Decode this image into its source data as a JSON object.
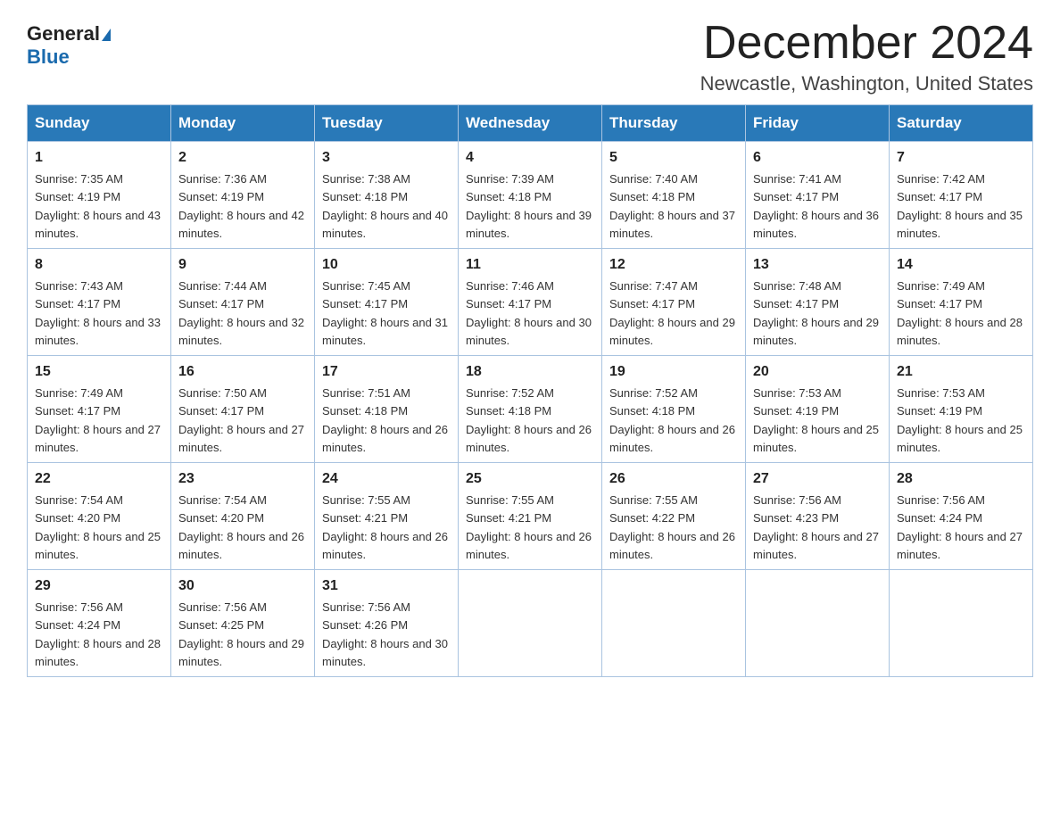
{
  "header": {
    "logo_general": "General",
    "logo_blue": "Blue",
    "month_title": "December 2024",
    "location": "Newcastle, Washington, United States"
  },
  "days_of_week": [
    "Sunday",
    "Monday",
    "Tuesday",
    "Wednesday",
    "Thursday",
    "Friday",
    "Saturday"
  ],
  "weeks": [
    [
      {
        "day": "1",
        "sunrise": "7:35 AM",
        "sunset": "4:19 PM",
        "daylight": "8 hours and 43 minutes."
      },
      {
        "day": "2",
        "sunrise": "7:36 AM",
        "sunset": "4:19 PM",
        "daylight": "8 hours and 42 minutes."
      },
      {
        "day": "3",
        "sunrise": "7:38 AM",
        "sunset": "4:18 PM",
        "daylight": "8 hours and 40 minutes."
      },
      {
        "day": "4",
        "sunrise": "7:39 AM",
        "sunset": "4:18 PM",
        "daylight": "8 hours and 39 minutes."
      },
      {
        "day": "5",
        "sunrise": "7:40 AM",
        "sunset": "4:18 PM",
        "daylight": "8 hours and 37 minutes."
      },
      {
        "day": "6",
        "sunrise": "7:41 AM",
        "sunset": "4:17 PM",
        "daylight": "8 hours and 36 minutes."
      },
      {
        "day": "7",
        "sunrise": "7:42 AM",
        "sunset": "4:17 PM",
        "daylight": "8 hours and 35 minutes."
      }
    ],
    [
      {
        "day": "8",
        "sunrise": "7:43 AM",
        "sunset": "4:17 PM",
        "daylight": "8 hours and 33 minutes."
      },
      {
        "day": "9",
        "sunrise": "7:44 AM",
        "sunset": "4:17 PM",
        "daylight": "8 hours and 32 minutes."
      },
      {
        "day": "10",
        "sunrise": "7:45 AM",
        "sunset": "4:17 PM",
        "daylight": "8 hours and 31 minutes."
      },
      {
        "day": "11",
        "sunrise": "7:46 AM",
        "sunset": "4:17 PM",
        "daylight": "8 hours and 30 minutes."
      },
      {
        "day": "12",
        "sunrise": "7:47 AM",
        "sunset": "4:17 PM",
        "daylight": "8 hours and 29 minutes."
      },
      {
        "day": "13",
        "sunrise": "7:48 AM",
        "sunset": "4:17 PM",
        "daylight": "8 hours and 29 minutes."
      },
      {
        "day": "14",
        "sunrise": "7:49 AM",
        "sunset": "4:17 PM",
        "daylight": "8 hours and 28 minutes."
      }
    ],
    [
      {
        "day": "15",
        "sunrise": "7:49 AM",
        "sunset": "4:17 PM",
        "daylight": "8 hours and 27 minutes."
      },
      {
        "day": "16",
        "sunrise": "7:50 AM",
        "sunset": "4:17 PM",
        "daylight": "8 hours and 27 minutes."
      },
      {
        "day": "17",
        "sunrise": "7:51 AM",
        "sunset": "4:18 PM",
        "daylight": "8 hours and 26 minutes."
      },
      {
        "day": "18",
        "sunrise": "7:52 AM",
        "sunset": "4:18 PM",
        "daylight": "8 hours and 26 minutes."
      },
      {
        "day": "19",
        "sunrise": "7:52 AM",
        "sunset": "4:18 PM",
        "daylight": "8 hours and 26 minutes."
      },
      {
        "day": "20",
        "sunrise": "7:53 AM",
        "sunset": "4:19 PM",
        "daylight": "8 hours and 25 minutes."
      },
      {
        "day": "21",
        "sunrise": "7:53 AM",
        "sunset": "4:19 PM",
        "daylight": "8 hours and 25 minutes."
      }
    ],
    [
      {
        "day": "22",
        "sunrise": "7:54 AM",
        "sunset": "4:20 PM",
        "daylight": "8 hours and 25 minutes."
      },
      {
        "day": "23",
        "sunrise": "7:54 AM",
        "sunset": "4:20 PM",
        "daylight": "8 hours and 26 minutes."
      },
      {
        "day": "24",
        "sunrise": "7:55 AM",
        "sunset": "4:21 PM",
        "daylight": "8 hours and 26 minutes."
      },
      {
        "day": "25",
        "sunrise": "7:55 AM",
        "sunset": "4:21 PM",
        "daylight": "8 hours and 26 minutes."
      },
      {
        "day": "26",
        "sunrise": "7:55 AM",
        "sunset": "4:22 PM",
        "daylight": "8 hours and 26 minutes."
      },
      {
        "day": "27",
        "sunrise": "7:56 AM",
        "sunset": "4:23 PM",
        "daylight": "8 hours and 27 minutes."
      },
      {
        "day": "28",
        "sunrise": "7:56 AM",
        "sunset": "4:24 PM",
        "daylight": "8 hours and 27 minutes."
      }
    ],
    [
      {
        "day": "29",
        "sunrise": "7:56 AM",
        "sunset": "4:24 PM",
        "daylight": "8 hours and 28 minutes."
      },
      {
        "day": "30",
        "sunrise": "7:56 AM",
        "sunset": "4:25 PM",
        "daylight": "8 hours and 29 minutes."
      },
      {
        "day": "31",
        "sunrise": "7:56 AM",
        "sunset": "4:26 PM",
        "daylight": "8 hours and 30 minutes."
      },
      null,
      null,
      null,
      null
    ]
  ],
  "labels": {
    "sunrise": "Sunrise:",
    "sunset": "Sunset:",
    "daylight": "Daylight:"
  }
}
